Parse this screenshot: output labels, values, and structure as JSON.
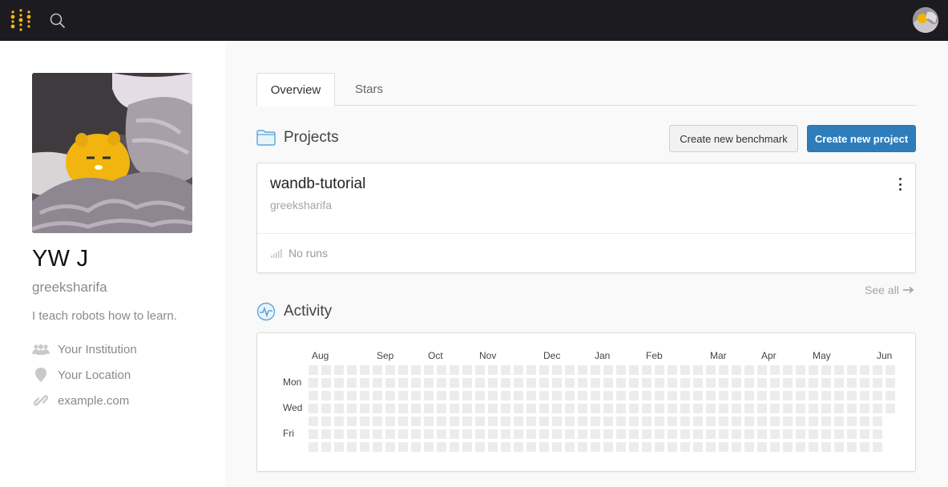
{
  "topbar": {
    "logo_icon": "wandb-logo-icon",
    "search_icon": "search-icon",
    "avatar_icon": "user-avatar",
    "accent_color": "#f5b914"
  },
  "profile": {
    "name": "YW J",
    "username": "greeksharifa",
    "bio": "I teach robots how to learn.",
    "institution": "Your Institution",
    "location": "Your Location",
    "website": "example.com"
  },
  "tabs": [
    {
      "label": "Overview",
      "active": true
    },
    {
      "label": "Stars",
      "active": false
    }
  ],
  "projects": {
    "title": "Projects",
    "create_benchmark_label": "Create new benchmark",
    "create_project_label": "Create new project",
    "primary_color": "#2e7dba",
    "items": [
      {
        "name": "wandb-tutorial",
        "owner": "greeksharifa",
        "runs_text": "No runs"
      }
    ],
    "see_all_label": "See all"
  },
  "activity": {
    "title": "Activity",
    "months": [
      "Aug",
      "Sep",
      "Oct",
      "Nov",
      "Dec",
      "Jan",
      "Feb",
      "Mar",
      "Apr",
      "May",
      "Jun"
    ],
    "day_labels": [
      "Mon",
      "Wed",
      "Fri"
    ],
    "cell_color": "#ececec"
  }
}
